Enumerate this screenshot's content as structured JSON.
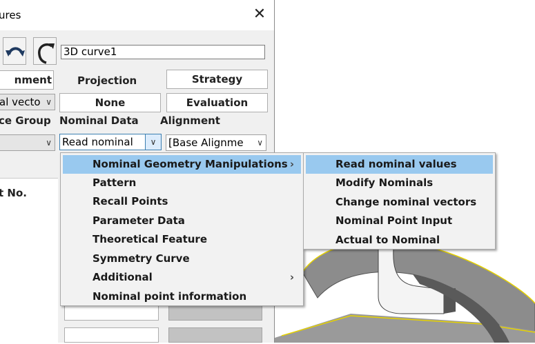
{
  "dialog": {
    "title": "ures",
    "close_glyph": "✕",
    "name_value": "3D curve1",
    "row1": {
      "alignment_btn": "nment",
      "projection_label": "Projection",
      "strategy_btn": "Strategy"
    },
    "row2": {
      "vector_combo": "al vecto",
      "projection_btn": "None",
      "evaluation_btn": "Evaluation"
    },
    "row3": {
      "group_label": "ce Group",
      "nominal_label": "Nominal Data",
      "alignment_label": "Alignment"
    },
    "row4": {
      "nominal_combo": "Read nominal",
      "alignment_combo": "[Base Alignme"
    },
    "panel_label": "t No."
  },
  "context_menu": {
    "items": [
      {
        "label": "Nominal Geometry Manipulations",
        "submenu": true,
        "selected": true
      },
      {
        "label": "Pattern",
        "submenu": false,
        "selected": false
      },
      {
        "label": "Recall Points",
        "submenu": false,
        "selected": false
      },
      {
        "label": "Parameter Data",
        "submenu": false,
        "selected": false
      },
      {
        "label": "Theoretical Feature",
        "submenu": false,
        "selected": false
      },
      {
        "label": "Symmetry Curve",
        "submenu": false,
        "selected": false
      },
      {
        "label": "Additional",
        "submenu": true,
        "selected": false
      },
      {
        "label": "Nominal point information",
        "submenu": false,
        "selected": false
      }
    ]
  },
  "submenu": {
    "items": [
      {
        "label": "Read nominal values",
        "selected": true
      },
      {
        "label": "Modify Nominals",
        "selected": false
      },
      {
        "label": "Change nominal vectors",
        "selected": false
      },
      {
        "label": "Nominal Point Input",
        "selected": false
      },
      {
        "label": "Actual to Nominal",
        "selected": false
      }
    ]
  },
  "icons": {
    "close": "close-icon",
    "undo": "undo-icon",
    "redo": "redo-icon",
    "chevron": "chevron-down-icon",
    "submenu_arrow": "chevron-right-icon"
  },
  "colors": {
    "menu_highlight": "#99c9ef",
    "dialog_bg": "#f0f0f0",
    "model_edge": "#e6d200"
  }
}
